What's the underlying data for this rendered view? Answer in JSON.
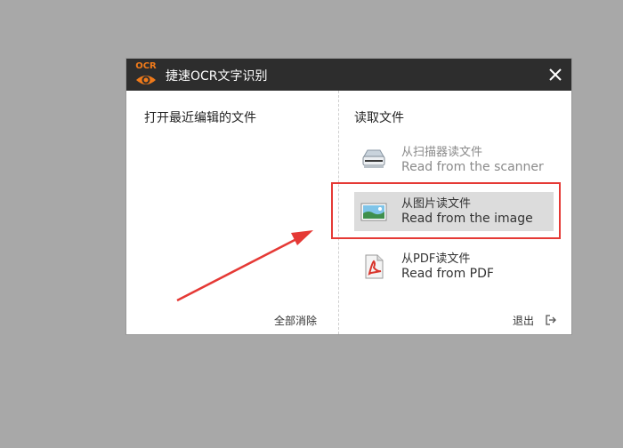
{
  "window": {
    "logo_text": "OCR",
    "title": "捷速OCR文字识别"
  },
  "left_panel": {
    "heading": "打开最近编辑的文件",
    "clear_all": "全部消除"
  },
  "right_panel": {
    "heading": "读取文件",
    "items": [
      {
        "zh": "从扫描器读文件",
        "en": "Read from the scanner",
        "state": "disabled",
        "icon": "scanner-icon"
      },
      {
        "zh": "从图片读文件",
        "en": "Read from the image",
        "state": "selected",
        "icon": "image-icon"
      },
      {
        "zh": "从PDF读文件",
        "en": "Read from PDF",
        "state": "normal",
        "icon": "pdf-icon"
      }
    ],
    "exit_label": "退出"
  },
  "annotation": {
    "highlight_color": "#e53935",
    "arrow_color": "#e53935"
  }
}
